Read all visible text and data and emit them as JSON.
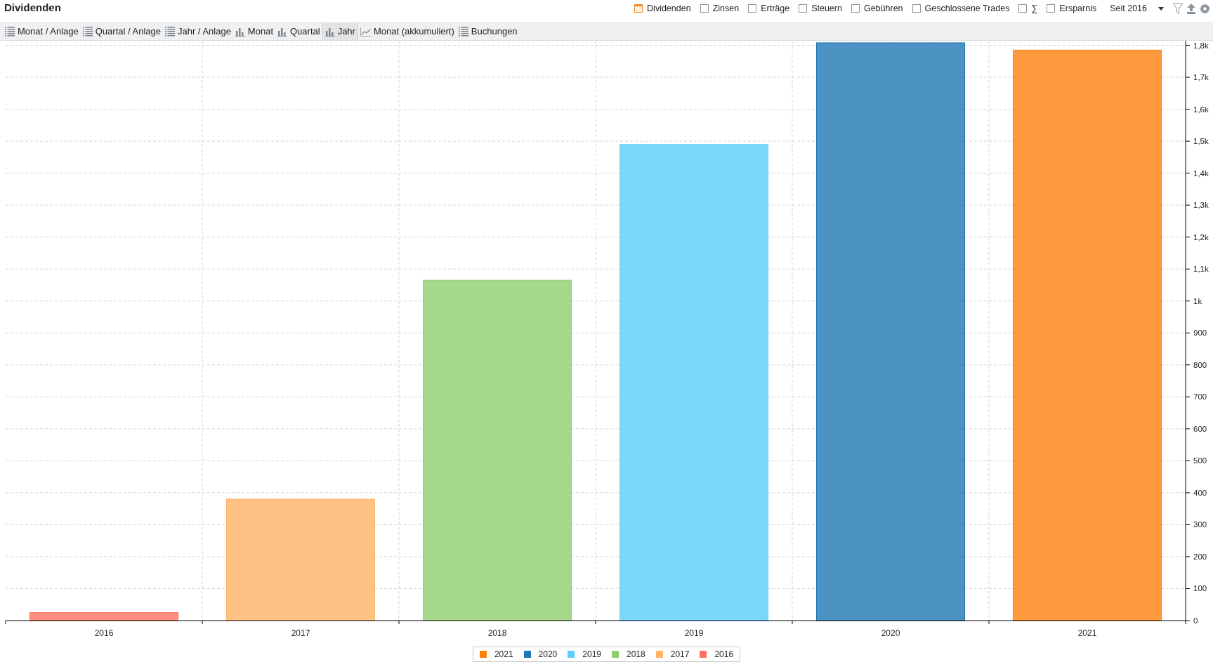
{
  "title": "Dividenden",
  "filters": [
    {
      "label": "Dividenden",
      "checked": true
    },
    {
      "label": "Zinsen",
      "checked": false
    },
    {
      "label": "Erträge",
      "checked": false
    },
    {
      "label": "Steuern",
      "checked": false
    },
    {
      "label": "Gebühren",
      "checked": false
    },
    {
      "label": "Geschlossene Trades",
      "checked": false
    },
    {
      "label": "∑",
      "checked": false
    },
    {
      "label": "Ersparnis",
      "checked": false
    }
  ],
  "period": {
    "value": "Seit 2016"
  },
  "views": [
    {
      "label": "Monat / Anlage",
      "kind": "list",
      "selected": false
    },
    {
      "label": "Quartal / Anlage",
      "kind": "list",
      "selected": false
    },
    {
      "label": "Jahr / Anlage",
      "kind": "list",
      "selected": false
    },
    {
      "label": "Monat",
      "kind": "bar",
      "selected": false
    },
    {
      "label": "Quartal",
      "kind": "bar",
      "selected": false
    },
    {
      "label": "Jahr",
      "kind": "bar",
      "selected": true
    },
    {
      "label": "Monat (akkumuliert)",
      "kind": "line",
      "selected": false
    },
    {
      "label": "Buchungen",
      "kind": "list",
      "selected": false
    }
  ],
  "chart_data": {
    "type": "bar",
    "categories": [
      "2016",
      "2017",
      "2018",
      "2019",
      "2020",
      "2021"
    ],
    "series": [
      {
        "name": "2021",
        "color": "#ff7f0e",
        "values": [
          null,
          null,
          null,
          null,
          null,
          1785
        ]
      },
      {
        "name": "2020",
        "color": "#1f77b4",
        "values": [
          null,
          null,
          null,
          null,
          1808,
          null
        ]
      },
      {
        "name": "2019",
        "color": "#5bcefa",
        "values": [
          null,
          null,
          null,
          1490,
          null,
          null
        ]
      },
      {
        "name": "2018",
        "color": "#8fce6e",
        "values": [
          null,
          null,
          1065,
          null,
          null,
          null
        ]
      },
      {
        "name": "2017",
        "color": "#ffb366",
        "values": [
          null,
          380,
          null,
          null,
          null,
          null
        ]
      },
      {
        "name": "2016",
        "color": "#ff7060",
        "values": [
          25,
          null,
          null,
          null,
          null,
          null
        ]
      }
    ],
    "ylim": [
      0,
      1810
    ],
    "yticks": [
      0,
      100,
      200,
      300,
      400,
      500,
      600,
      700,
      800,
      900,
      {
        "value": 1000,
        "label": "1k"
      },
      {
        "value": 1100,
        "label": "1,1k"
      },
      {
        "value": 1200,
        "label": "1,2k"
      },
      {
        "value": 1300,
        "label": "1,3k"
      },
      {
        "value": 1400,
        "label": "1,4k"
      },
      {
        "value": 1500,
        "label": "1,5k"
      },
      {
        "value": 1600,
        "label": "1,6k"
      },
      {
        "value": 1700,
        "label": "1,7k"
      },
      {
        "value": 1800,
        "label": "1,8k"
      }
    ],
    "stacked": true,
    "grid": true
  }
}
